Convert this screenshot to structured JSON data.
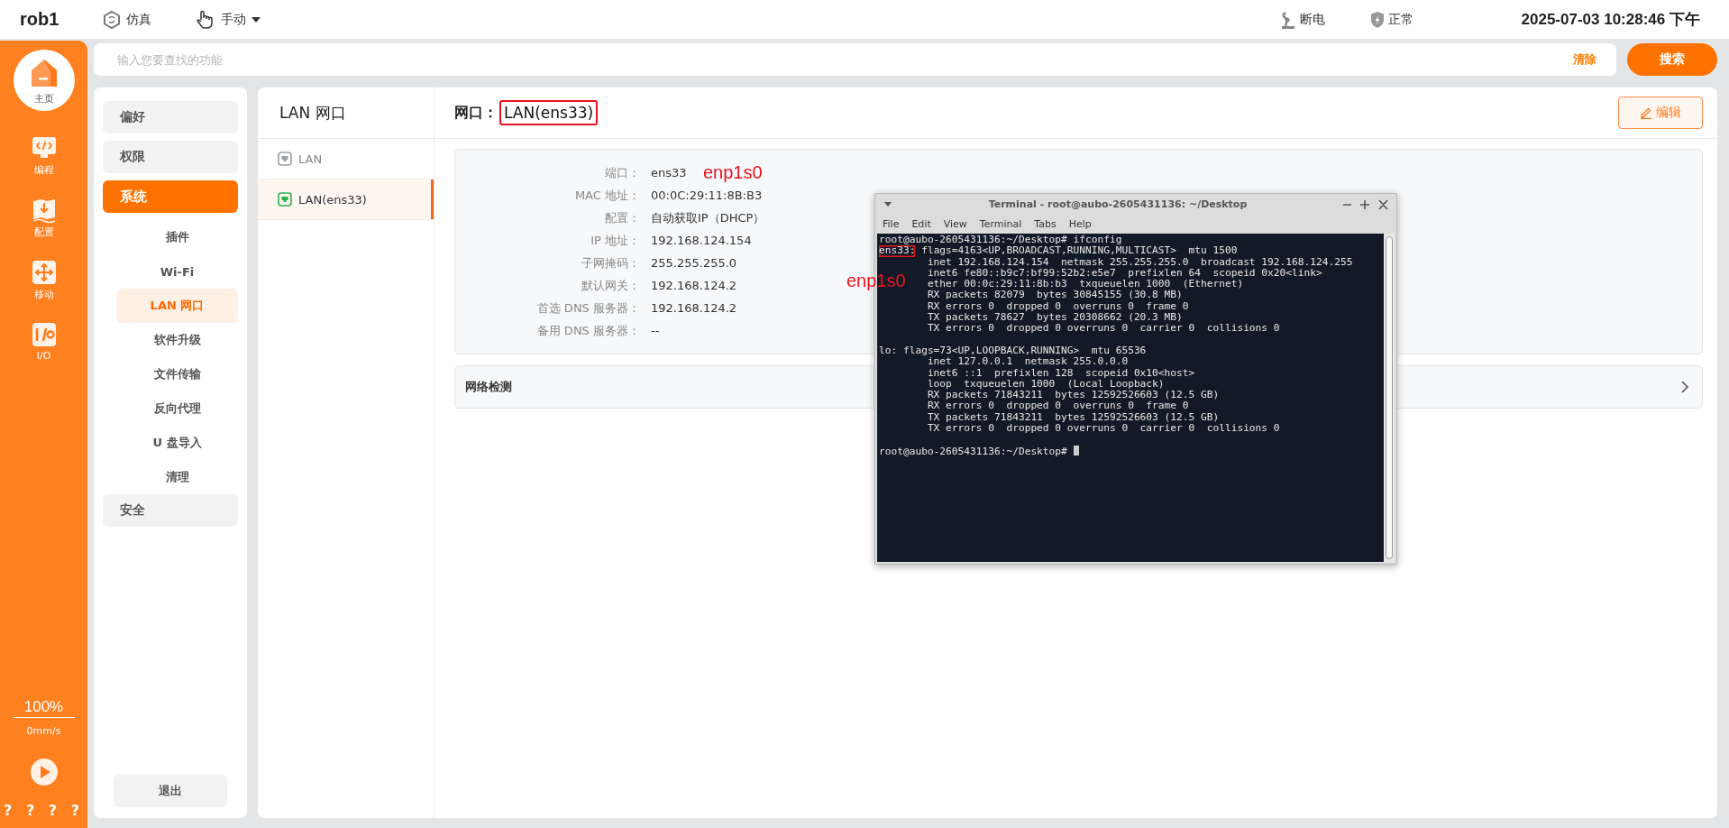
{
  "topbar": {
    "title": "rob1",
    "mode": "仿真",
    "control": "手动",
    "power": "断电",
    "status": "正常",
    "datetime": "2025-07-03 10:28:46 下午"
  },
  "sidebar": {
    "items": [
      {
        "label": "主页",
        "kind": "home",
        "selected": true
      },
      {
        "label": "编程",
        "kind": "code",
        "selected": false
      },
      {
        "label": "配置",
        "kind": "config",
        "selected": false
      },
      {
        "label": "移动",
        "kind": "move",
        "selected": false
      },
      {
        "label": "I/O",
        "kind": "io",
        "selected": false
      }
    ],
    "speed_percent": "100%",
    "speed": "0mm/s",
    "footer": "? ? ? ?"
  },
  "search": {
    "placeholder": "输入您要查找的功能",
    "clear": "清除",
    "button": "搜索"
  },
  "nav": {
    "items": [
      {
        "label": "偏好",
        "selected": false
      },
      {
        "label": "权限",
        "selected": false
      },
      {
        "label": "系统",
        "selected": true,
        "children": [
          {
            "label": "插件",
            "selected": false
          },
          {
            "label": "Wi-Fi",
            "selected": false
          },
          {
            "label": "LAN 网口",
            "selected": true
          },
          {
            "label": "软件升级",
            "selected": false
          },
          {
            "label": "文件传输",
            "selected": false
          },
          {
            "label": "反向代理",
            "selected": false
          },
          {
            "label": "U 盘导入",
            "selected": false
          },
          {
            "label": "清理",
            "selected": false
          }
        ]
      },
      {
        "label": "安全",
        "selected": false
      }
    ],
    "logout": "退出"
  },
  "interfaces": {
    "title": "LAN 网口",
    "items": [
      {
        "label": "LAN",
        "selected": false
      },
      {
        "label": "LAN(ens33)",
        "selected": true
      }
    ]
  },
  "detail": {
    "label": "网口：",
    "value": "LAN(ens33)",
    "highlighted": true,
    "edit": "编辑",
    "fields": [
      {
        "label": "端口：",
        "value": "ens33"
      },
      {
        "label": "MAC 地址：",
        "value": "00:0C:29:11:8B:B3"
      },
      {
        "label": "配置：",
        "value": "自动获取IP（DHCP）"
      },
      {
        "label": "IP 地址：",
        "value": "192.168.124.154"
      },
      {
        "label": "子网掩码：",
        "value": "255.255.255.0"
      },
      {
        "label": "默认网关：",
        "value": "192.168.124.2"
      },
      {
        "label": "首选 DNS 服务器：",
        "value": "192.168.124.2"
      },
      {
        "label": "备用 DNS 服务器：",
        "value": "--"
      }
    ],
    "network_check": "网络检测"
  },
  "annotations": [
    "enp1s0",
    "enp1s0"
  ],
  "terminal": {
    "title": "Terminal - root@aubo-2605431136: ~/Desktop",
    "menu": [
      "File",
      "Edit",
      "View",
      "Terminal",
      "Tabs",
      "Help"
    ],
    "blocks": [
      [
        {
          "text": "root@aubo-2605431136:~/Desktop# ifconfig"
        },
        {
          "label": "ens33:",
          "highlighted": true,
          "text": " flags=4163<UP,BROADCAST,RUNNING,MULTICAST>  mtu 1500"
        },
        {
          "text": "        inet 192.168.124.154  netmask 255.255.255.0  broadcast 192.168.124.255"
        },
        {
          "text": "        inet6 fe80::b9c7:bf99:52b2:e5e7  prefixlen 64  scopeid 0x20<link>"
        },
        {
          "text": "        ether 00:0c:29:11:8b:b3  txqueuelen 1000  (Ethernet)"
        },
        {
          "text": "        RX packets 82079  bytes 30845155 (30.8 MB)"
        },
        {
          "text": "        RX errors 0  dropped 0  overruns 0  frame 0"
        },
        {
          "text": "        TX packets 78627  bytes 20308662 (20.3 MB)"
        },
        {
          "text": "        TX errors 0  dropped 0 overruns 0  carrier 0  collisions 0"
        }
      ],
      [
        {
          "text": "lo: flags=73<UP,LOOPBACK,RUNNING>  mtu 65536"
        },
        {
          "text": "        inet 127.0.0.1  netmask 255.0.0.0"
        },
        {
          "text": "        inet6 ::1  prefixlen 128  scopeid 0x10<host>"
        },
        {
          "text": "        loop  txqueuelen 1000  (Local Loopback)"
        },
        {
          "text": "        RX packets 71843211  bytes 12592526603 (12.5 GB)"
        },
        {
          "text": "        RX errors 0  dropped 0  overruns 0  frame 0"
        },
        {
          "text": "        TX packets 71843211  bytes 12592526603 (12.5 GB)"
        },
        {
          "text": "        TX errors 0  dropped 0 overruns 0  carrier 0  collisions 0"
        }
      ],
      [
        {
          "text": "root@aubo-2605431136:~/Desktop# ",
          "cursor": true
        }
      ]
    ]
  }
}
